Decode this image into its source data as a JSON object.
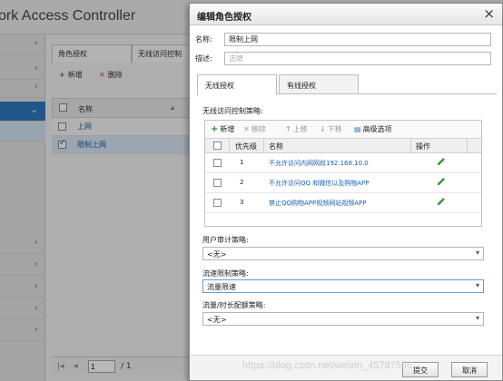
{
  "app": {
    "title": "ork Access Controller",
    "tabs": [
      "角色授权",
      "无线访问控制"
    ],
    "toolbar": {
      "add_label": "新增",
      "delete_label": "删除"
    },
    "table": {
      "header": "名称",
      "rows": [
        {
          "name": "上网",
          "checked": false
        },
        {
          "name": "限制上网",
          "checked": true
        }
      ]
    },
    "pager": {
      "page_input": "1",
      "page_text": "/ 1"
    }
  },
  "dialog": {
    "title": "编辑角色授权",
    "name_label": "名称:",
    "name_value": "限制上网",
    "desc_label": "描述:",
    "desc_placeholder": "选填",
    "tabs": [
      "无线授权",
      "有线授权"
    ],
    "acl": {
      "section_label": "无线访问控制策略:",
      "toolbar": {
        "add": "新增",
        "remove": "移除",
        "up": "上移",
        "down": "下移",
        "advanced": "高级选项"
      },
      "columns": {
        "priority": "优先级",
        "name": "名称",
        "action": "操作"
      },
      "rows": [
        {
          "priority": "1",
          "name": "不允许访问内网网段192.168.10.0"
        },
        {
          "priority": "2",
          "name": "不允许访问QQ 和微信以及购物APP"
        },
        {
          "priority": "3",
          "name": "禁止QQ购物APP视频网站视频APP"
        }
      ]
    },
    "audit": {
      "label": "用户审计策略:",
      "value": "<无>"
    },
    "rate": {
      "label": "流速限制策略:",
      "value": "流量限速"
    },
    "quota": {
      "label": "流量/时长配额策略:",
      "value": "<无>"
    },
    "footer": {
      "submit": "提交",
      "cancel": "取消"
    }
  },
  "watermark": "https://blog.csdn.net/weixin_45787536",
  "colors": {
    "accent": "#2f79bd",
    "link": "#1d5fb3",
    "add_green": "#2e8b2e",
    "remove_red": "#d9432e"
  }
}
